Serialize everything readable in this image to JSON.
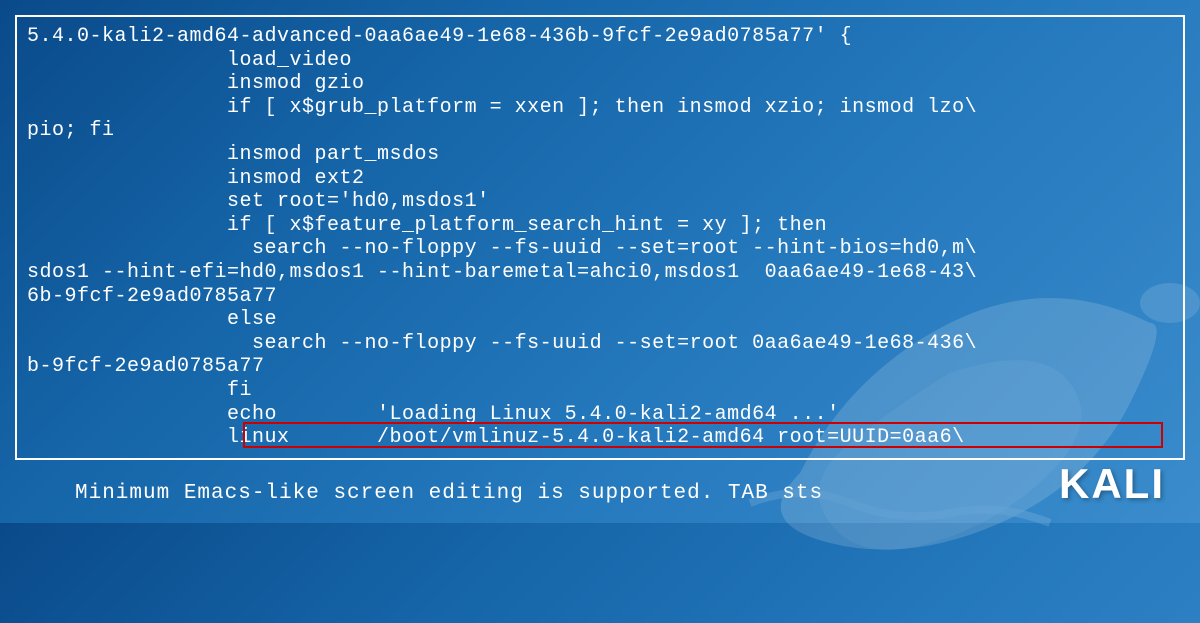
{
  "grub_editor": {
    "lines": [
      "5.4.0-kali2-amd64-advanced-0aa6ae49-1e68-436b-9fcf-2e9ad0785a77' {",
      "                load_video",
      "                insmod gzio",
      "                if [ x$grub_platform = xxen ]; then insmod xzio; insmod lzo\\",
      "pio; fi",
      "                insmod part_msdos",
      "                insmod ext2",
      "                set root='hd0,msdos1'",
      "                if [ x$feature_platform_search_hint = xy ]; then",
      "                  search --no-floppy --fs-uuid --set=root --hint-bios=hd0,m\\",
      "sdos1 --hint-efi=hd0,msdos1 --hint-baremetal=ahci0,msdos1  0aa6ae49-1e68-43\\",
      "6b-9fcf-2e9ad0785a77",
      "                else",
      "                  search --no-floppy --fs-uuid --set=root 0aa6ae49-1e68-436\\",
      "b-9fcf-2e9ad0785a77",
      "                fi",
      "                echo        'Loading Linux 5.4.0-kali2-amd64 ...'"
    ],
    "highlighted_line": "                linux       /boot/vmlinuz-5.4.0-kali2-amd64 root=UUID=0aa6\\"
  },
  "bottom_hint": "Minimum Emacs-like screen editing is supported. TAB   sts",
  "logo_text": "KALI"
}
